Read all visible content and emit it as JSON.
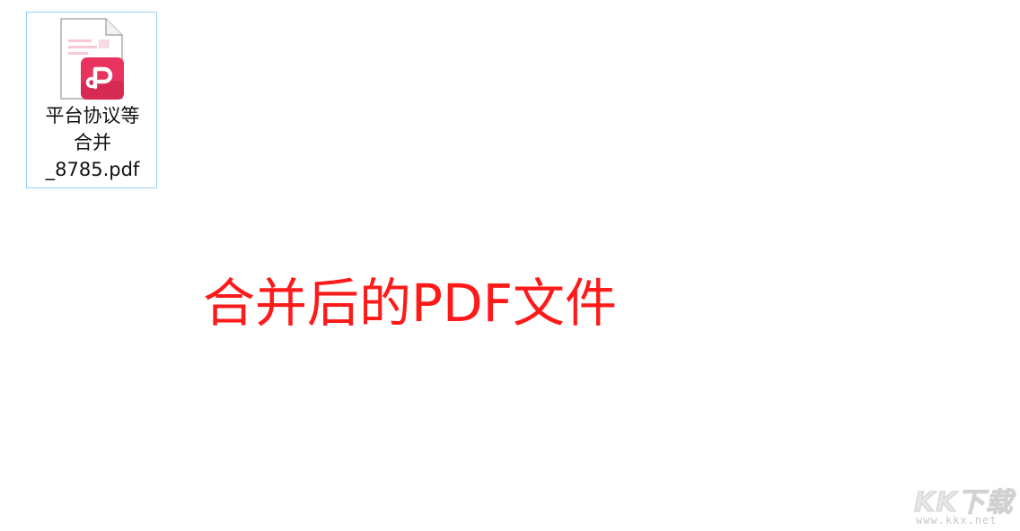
{
  "file": {
    "name_line1": "平台协议等",
    "name_line2": "合并",
    "name_line3": "_8785.pdf",
    "icon": "pdf-file-icon",
    "selected": true
  },
  "caption": "合并后的PDF文件",
  "watermark": {
    "logo": "KK下载",
    "url": "www.kkx.net"
  },
  "colors": {
    "caption": "#ff1a1a",
    "selection_border": "#99d1ff",
    "pdf_badge": "#e8335e"
  }
}
